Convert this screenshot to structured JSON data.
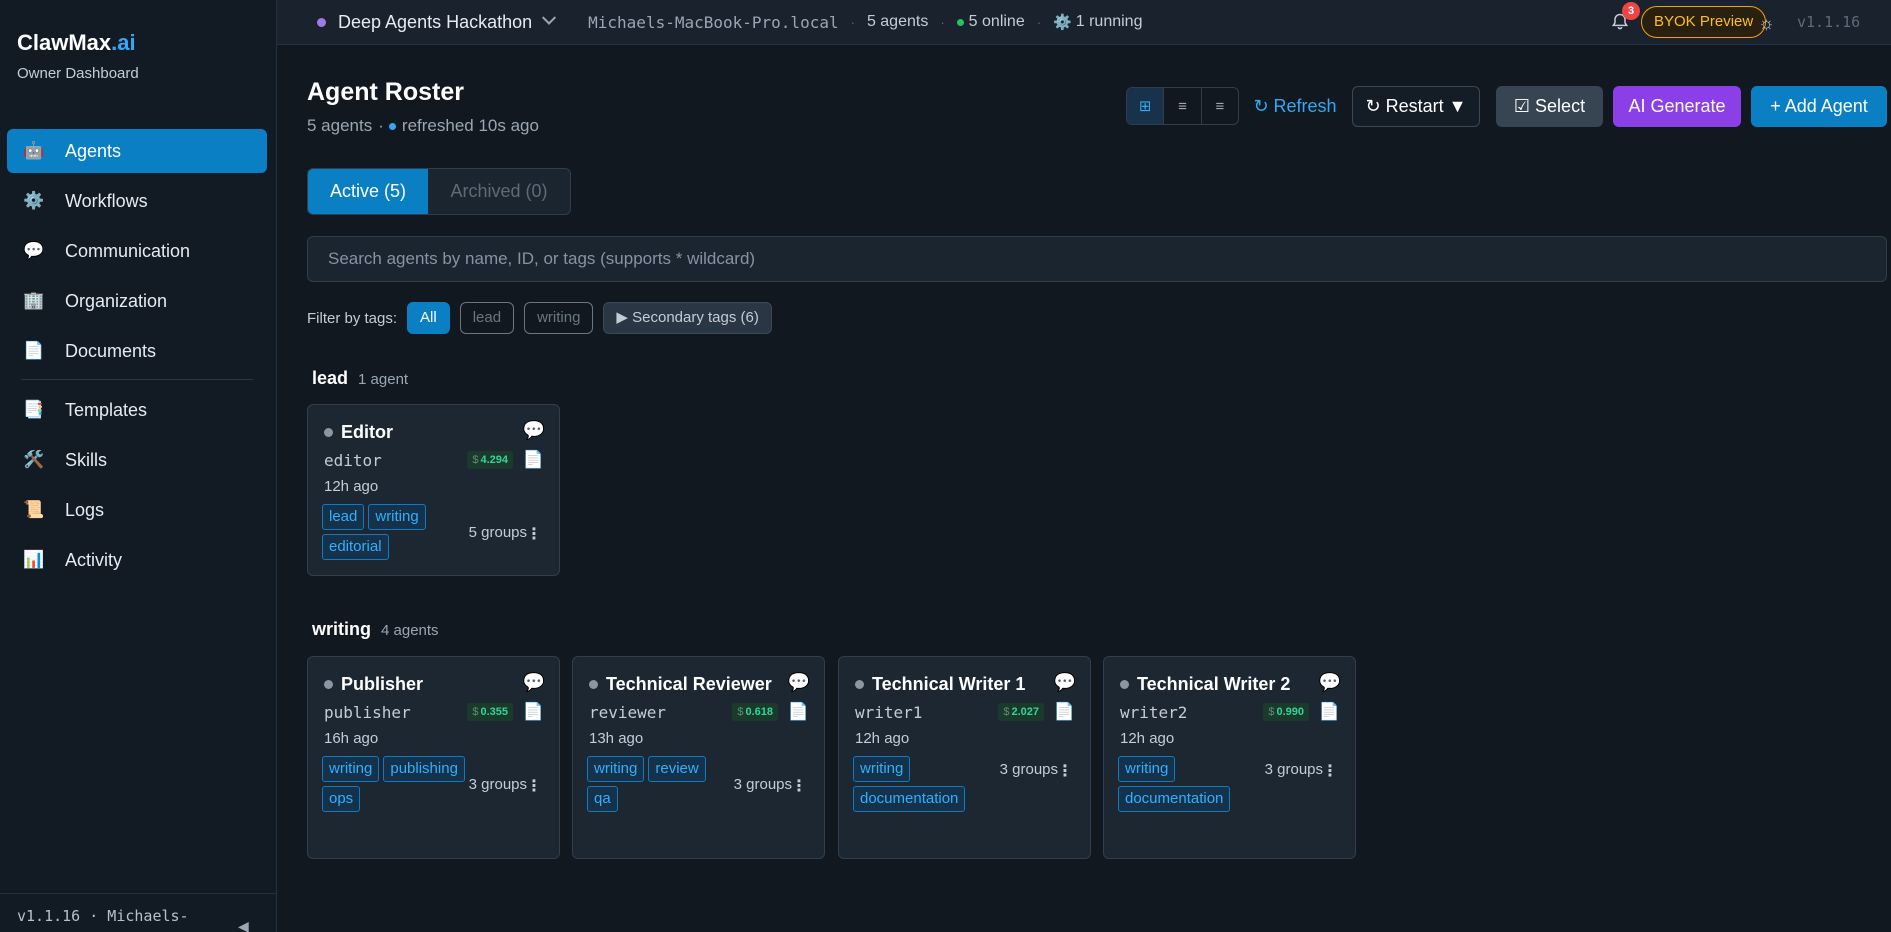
{
  "brand": {
    "name": "ClawMax",
    "tld": ".ai",
    "subtitle": "Owner Dashboard"
  },
  "sidebar": {
    "items": [
      {
        "label": "Agents",
        "icon": "robot-icon",
        "glyph": "🤖",
        "active": true
      },
      {
        "label": "Workflows",
        "icon": "gear-icon",
        "glyph": "⚙️"
      },
      {
        "label": "Communication",
        "icon": "speech-bubble-icon",
        "glyph": "💬"
      },
      {
        "label": "Organization",
        "icon": "building-icon",
        "glyph": "🏢"
      },
      {
        "label": "Documents",
        "icon": "document-icon",
        "glyph": "📄"
      },
      {
        "label": "Templates",
        "icon": "template-icon",
        "glyph": "📑"
      },
      {
        "label": "Skills",
        "icon": "tools-icon",
        "glyph": "🛠️"
      },
      {
        "label": "Logs",
        "icon": "scroll-icon",
        "glyph": "📜"
      },
      {
        "label": "Activity",
        "icon": "bar-chart-icon",
        "glyph": "📊"
      }
    ],
    "footer": "v1.1.16 · Michaels-",
    "collapse_glyph": "◀"
  },
  "topbar": {
    "workspace": "Deep Agents Hackathon",
    "host": "Michaels-MacBook-Pro.local",
    "agents": "5 agents",
    "online": "5 online",
    "running": "1 running",
    "running_glyph": "⚙️",
    "notif_count": "3",
    "byok": "BYOK Preview",
    "theme_glyph": "☼",
    "version": "v1.1.16"
  },
  "header": {
    "title": "Agent Roster",
    "count": "5 agents",
    "refreshed": "refreshed 10s ago"
  },
  "toolbar": {
    "view_grid": "⊞",
    "view_list": "≡",
    "view_compact": "≡",
    "refresh": "↻ Refresh",
    "restart": "↻ Restart ▼",
    "select": "☑  Select",
    "ai_generate": "AI Generate",
    "add_agent": "+ Add Agent"
  },
  "tabs": {
    "active": "Active (5)",
    "archived": "Archived (0)"
  },
  "search": {
    "placeholder": "Search agents by name, ID, or tags (supports * wildcard)"
  },
  "filter": {
    "label": "Filter by tags:",
    "all": "All",
    "lead": "lead",
    "writing": "writing",
    "secondary": "▶ Secondary tags (6)"
  },
  "groups": [
    {
      "name": "lead",
      "count": "1 agent",
      "agents": [
        {
          "name": "Editor",
          "id": "editor",
          "cost": "4.294",
          "ago": "12h ago",
          "tags": [
            "lead",
            "writing",
            "editorial"
          ],
          "groups": "5 groups"
        }
      ]
    },
    {
      "name": "writing",
      "count": "4 agents",
      "agents": [
        {
          "name": "Publisher",
          "id": "publisher",
          "cost": "0.355",
          "ago": "16h ago",
          "tags": [
            "writing",
            "publishing",
            "ops"
          ],
          "groups": "3 groups"
        },
        {
          "name": "Technical Reviewer",
          "id": "reviewer",
          "cost": "0.618",
          "ago": "13h ago",
          "tags": [
            "writing",
            "review",
            "qa"
          ],
          "groups": "3 groups"
        },
        {
          "name": "Technical Writer 1",
          "id": "writer1",
          "cost": "2.027",
          "ago": "12h ago",
          "tags": [
            "writing",
            "documentation"
          ],
          "groups": "3 groups"
        },
        {
          "name": "Technical Writer 2",
          "id": "writer2",
          "cost": "0.990",
          "ago": "12h ago",
          "tags": [
            "writing",
            "documentation"
          ],
          "groups": "3 groups"
        }
      ]
    }
  ],
  "card_icons": {
    "chat": "💬",
    "doc": "📄",
    "kebab": "⋮",
    "dollar": "$"
  }
}
